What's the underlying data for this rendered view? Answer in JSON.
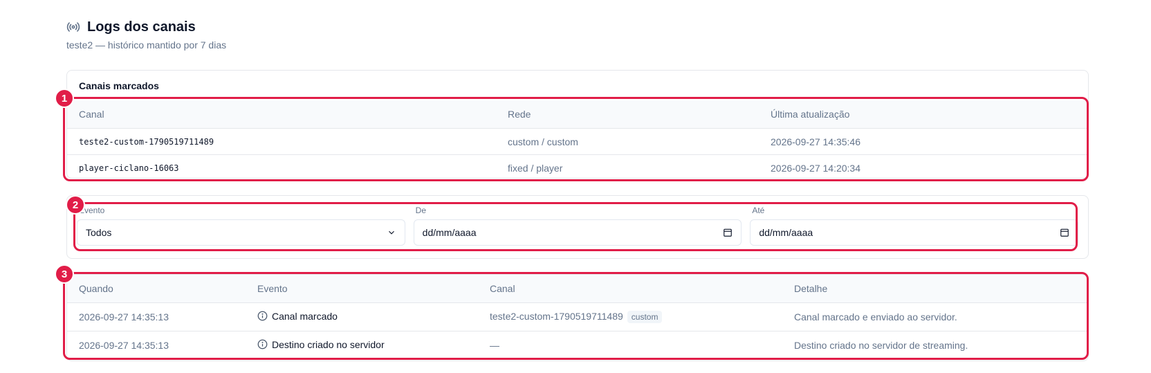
{
  "header": {
    "title": "Logs dos canais",
    "icon": "broadcast-icon",
    "subtitle": "teste2 — histórico mantido por 7 dias"
  },
  "marked_channels": {
    "title": "Canais marcados",
    "columns": [
      "Canal",
      "Rede",
      "Última atualização"
    ],
    "rows": [
      {
        "channel": "teste2-custom-1790519711489",
        "network": "custom / custom",
        "updated": "2026-09-27 14:35:46"
      },
      {
        "channel": "player-ciclano-16063",
        "network": "fixed / player",
        "updated": "2026-09-27 14:20:34"
      }
    ]
  },
  "filters": {
    "event": {
      "label": "Evento",
      "value": "Todos"
    },
    "from": {
      "label": "De",
      "placeholder": "dd/mm/aaaa"
    },
    "to": {
      "label": "Até",
      "placeholder": "dd/mm/aaaa"
    }
  },
  "logs": {
    "columns": [
      "Quando",
      "Evento",
      "Canal",
      "Detalhe"
    ],
    "rows": [
      {
        "when": "2026-09-27 14:35:13",
        "event": "Canal marcado",
        "channel": "teste2-custom-1790519711489",
        "chip": "custom",
        "detail": "Canal marcado e enviado ao servidor."
      },
      {
        "when": "2026-09-27 14:35:13",
        "event": "Destino criado no servidor",
        "channel": "—",
        "chip": "",
        "detail": "Destino criado no servidor de streaming."
      }
    ]
  },
  "annotations": [
    "1",
    "2",
    "3"
  ],
  "colors": {
    "accent": "#e11d48",
    "muted": "#64748b"
  }
}
